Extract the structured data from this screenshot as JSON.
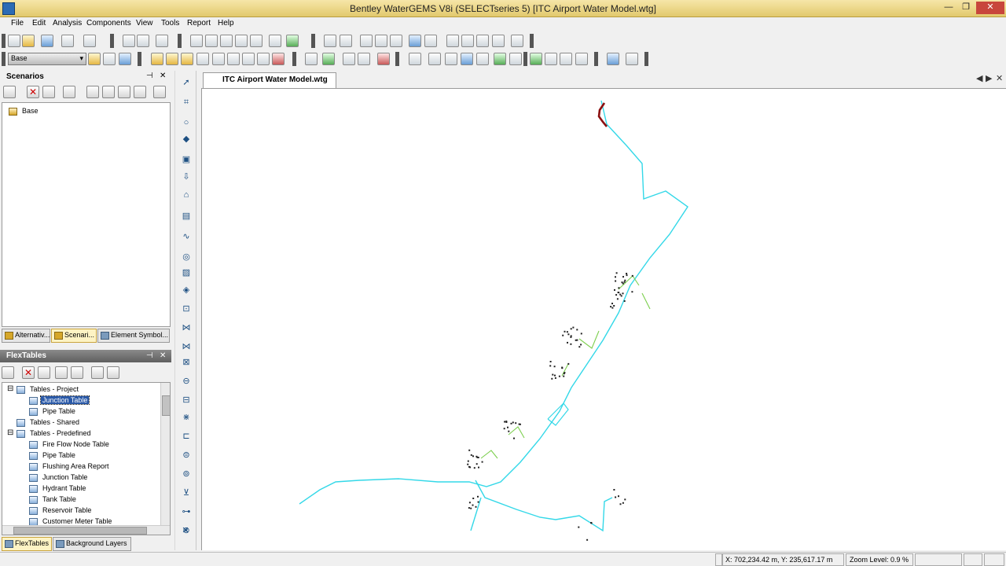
{
  "app": {
    "title": "Bentley WaterGEMS V8i (SELECTseries 5) [ITC Airport Water Model.wtg]",
    "window_controls": {
      "minimize": "—",
      "restore": "❐",
      "close": "✕"
    }
  },
  "menu": [
    "File",
    "Edit",
    "Analysis",
    "Components",
    "View",
    "Tools",
    "Report",
    "Help"
  ],
  "toolbar": {
    "scenario_select": "Base"
  },
  "scenarios_panel": {
    "title": "Scenarios",
    "pin_glyph": "⊣",
    "close_glyph": "✕",
    "tree": [
      {
        "label": "Base"
      }
    ],
    "tabs": [
      "Alternativ...",
      "Scenari...",
      "Element Symbol..."
    ]
  },
  "flextables_panel": {
    "title": "FlexTables",
    "pin_glyph": "⊣",
    "close_glyph": "✕",
    "tree": [
      {
        "label": "Tables - Project",
        "level": 0,
        "expander": "⊟"
      },
      {
        "label": "Junction Table",
        "level": 1,
        "selected": true
      },
      {
        "label": "Pipe Table",
        "level": 1
      },
      {
        "label": "Tables - Shared",
        "level": 0
      },
      {
        "label": "Tables - Predefined",
        "level": 0,
        "expander": "⊟"
      },
      {
        "label": "Fire Flow Node Table",
        "level": 1
      },
      {
        "label": "Pipe Table",
        "level": 1
      },
      {
        "label": "Flushing Area Report",
        "level": 1
      },
      {
        "label": "Junction Table",
        "level": 1
      },
      {
        "label": "Hydrant Table",
        "level": 1
      },
      {
        "label": "Tank Table",
        "level": 1
      },
      {
        "label": "Reservoir Table",
        "level": 1
      },
      {
        "label": "Customer Meter Table",
        "level": 1
      }
    ],
    "tabs": [
      "FlexTables",
      "Background Layers"
    ]
  },
  "drawing": {
    "tab_label": "ITC Airport Water Model.wtg",
    "nav": {
      "left": "◀",
      "right": "▶",
      "close": "✕"
    },
    "colors": {
      "main_pipe": "#33d8e8",
      "highlight_pipe": "#8b1010",
      "branch_pipe": "#7ccf4e",
      "junction": "#222222"
    }
  },
  "status": {
    "coordinates": "X: 702,234.42 m, Y: 235,617.17 m",
    "zoom": "Zoom Level: 0.9 %"
  }
}
